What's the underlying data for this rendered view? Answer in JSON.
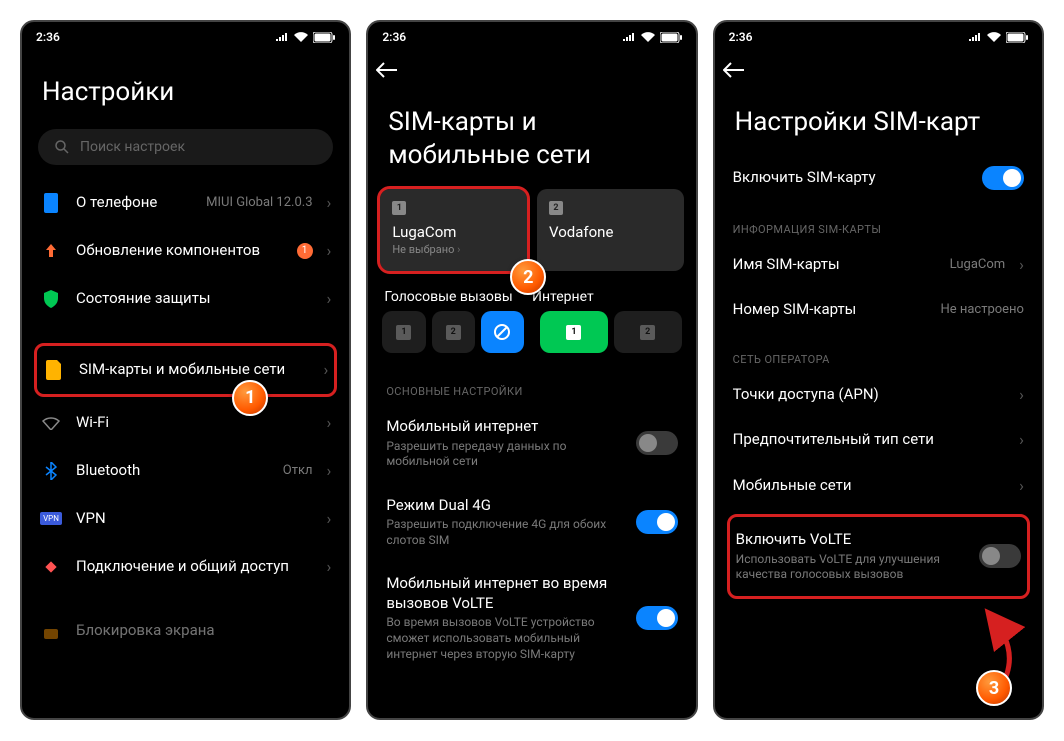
{
  "status": {
    "time": "2:36"
  },
  "screen1": {
    "title": "Настройки",
    "search_placeholder": "Поиск настроек",
    "about_label": "О телефоне",
    "about_value": "MIUI Global 12.0.3",
    "update_label": "Обновление компонентов",
    "update_badge": "1",
    "security_label": "Состояние защиты",
    "sim_label": "SIM-карты и мобильные сети",
    "wifi_label": "Wi-Fi",
    "bt_label": "Bluetooth",
    "bt_value": "Откл",
    "vpn_label": "VPN",
    "share_label": "Подключение и общий доступ",
    "lock_label": "Блокировка экрана",
    "bubble1": "1"
  },
  "screen2": {
    "title": "SIM-карты и мобильные сети",
    "sim1_name": "LugaCom",
    "sim1_status": "Не выбрано",
    "sim2_name": "Vodafone",
    "voice_label": "Голосовые вызовы",
    "internet_label": "Интернет",
    "section_main": "ОСНОВНЫЕ НАСТРОЙКИ",
    "mobile_data_label": "Мобильный интернет",
    "mobile_data_sub": "Разрешить передачу данных по мобильной сети",
    "dual4g_label": "Режим Dual 4G",
    "dual4g_sub": "Разрешить подключение 4G для обоих слотов SIM",
    "volte_call_label": "Мобильный интернет во время вызовов VoLTE",
    "volte_call_sub": "Во время вызовов VoLTE устройство сможет использовать мобильный интернет через вторую SIM-карту",
    "bubble2": "2"
  },
  "screen3": {
    "title": "Настройки SIM-карт",
    "enable_sim_label": "Включить SIM-карту",
    "section_info": "ИНФОРМАЦИЯ SIM-КАРТЫ",
    "sim_name_label": "Имя SIM-карты",
    "sim_name_value": "LugaCom",
    "sim_num_label": "Номер SIM-карты",
    "sim_num_value": "Не настроено",
    "section_network": "СЕТЬ ОПЕРАТОРА",
    "apn_label": "Точки доступа (APN)",
    "pref_net_label": "Предпочтительный тип сети",
    "mobile_net_label": "Мобильные сети",
    "volte_label": "Включить VoLTE",
    "volte_sub": "Использовать VoLTE для улучшения качества голосовых вызовов",
    "bubble3": "3"
  }
}
